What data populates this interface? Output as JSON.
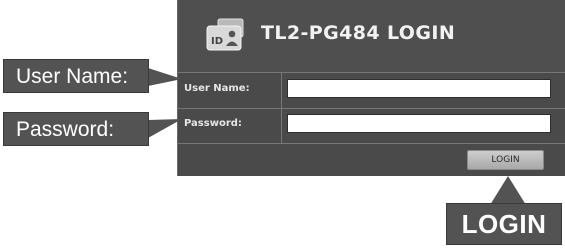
{
  "header": {
    "title": "TL2-PG484 LOGIN",
    "icon": "id-card-icon",
    "icon_text": "ID"
  },
  "form": {
    "username_label": "User Name:",
    "username_value": "",
    "password_label": "Password:",
    "password_value": ""
  },
  "login_button": "LOGIN",
  "callouts": {
    "user": "User Name:",
    "password": "Password:",
    "login": "LOGIN"
  },
  "colors": {
    "panel": "#4a4a4a",
    "callout": "#535353",
    "button": "#bdbdbd"
  }
}
